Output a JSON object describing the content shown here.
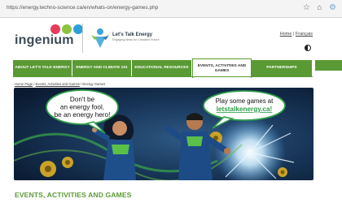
{
  "browser": {
    "url": "https://energy.techno-science.ca/en/whats-on/energy-games.php",
    "icons": [
      "star-icon",
      "home-icon",
      "gear-icon"
    ]
  },
  "header": {
    "ingenium_logo_text": "ingenium",
    "lte_title": "Let's Talk Energy",
    "lte_tagline": "Engaging Ideas for Canada's Future",
    "links": {
      "home": "Home",
      "separator": "|",
      "lang": "Français"
    }
  },
  "nav": {
    "items": [
      {
        "label": "ABOUT LET'S TALK ENERGY"
      },
      {
        "label": "ENERGY AND CLIMATE 101"
      },
      {
        "label": "EDUCATIONAL RESOURCES"
      },
      {
        "label": "EVENTS, ACTIVITIES AND GAMES",
        "active": true
      },
      {
        "label": "PARTNERSHIPS"
      }
    ]
  },
  "breadcrumb": {
    "home": "Home Page",
    "sep1": "/",
    "events": "Events, Activities and Games",
    "sep2": "/",
    "current": "Energy Games"
  },
  "banner": {
    "bubble_left": [
      "Don't be",
      "an energy fool,",
      "be an energy hero!"
    ],
    "bubble_right": [
      "Play some games at",
      "letstalkenergy.ca!"
    ]
  },
  "page": {
    "heading": "EVENTS, ACTIVITIES AND GAMES"
  },
  "colors": {
    "brand_green": "#5a9a34",
    "heading_green": "#5e9a37",
    "bubble_green": "#2e9e4a"
  }
}
